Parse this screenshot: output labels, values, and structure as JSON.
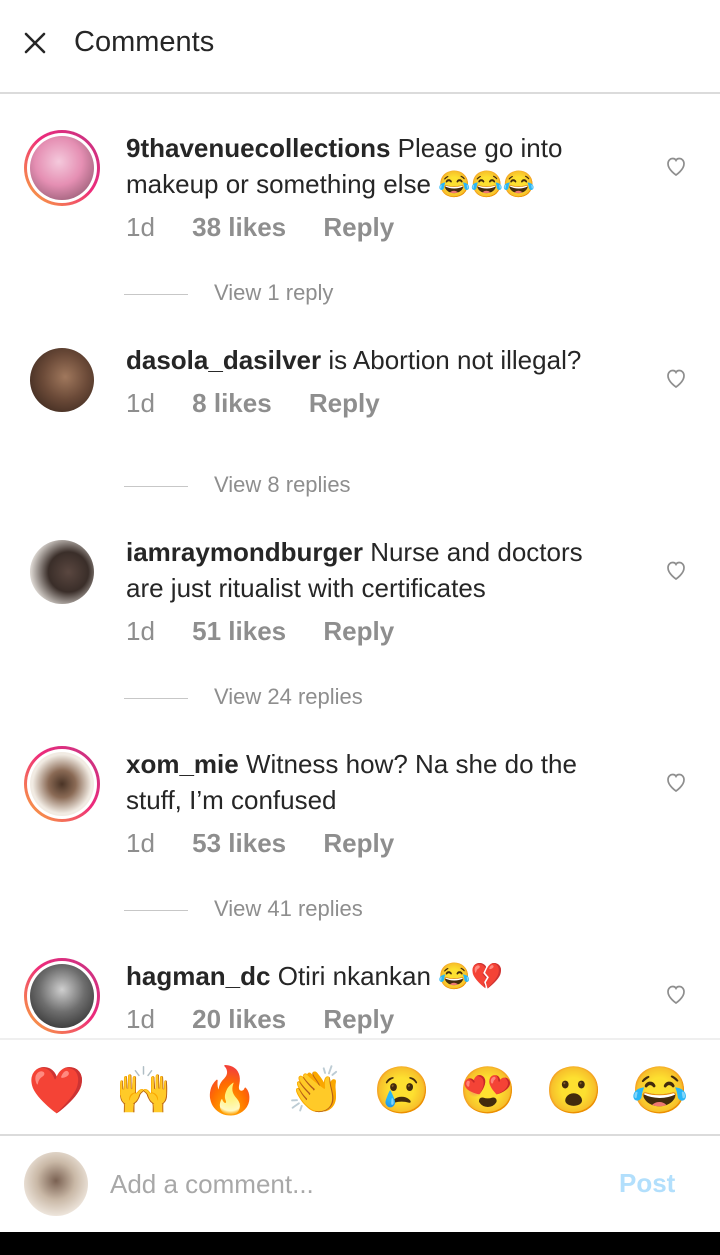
{
  "header": {
    "title": "Comments",
    "close_icon": "close-icon"
  },
  "comments": [
    {
      "username": "9thavenuecollections",
      "text": "Please go into makeup or something else 😂😂😂",
      "time": "1d",
      "likes": "38 likes",
      "reply": "Reply",
      "avatar_colors": [
        "#e9a6c4",
        "#7a4a5e"
      ],
      "story_ring": true,
      "view_replies": "View 1 reply"
    },
    {
      "username": "dasola_dasilver",
      "text": "is Abortion not illegal?",
      "time": "1d",
      "likes": "8 likes",
      "reply": "Reply",
      "avatar_colors": [
        "#6b4a38",
        "#2c1d16"
      ],
      "story_ring": false,
      "view_replies": "View 8 replies"
    },
    {
      "username": "iamraymondburger",
      "text": "Nurse and doctors are just ritualist with certificates",
      "time": "1d",
      "likes": "51 likes",
      "reply": "Reply",
      "avatar_colors": [
        "#d9d4cf",
        "#3a2e29"
      ],
      "story_ring": false,
      "view_replies": "View 24 replies"
    },
    {
      "username": "xom_mie",
      "text": "Witness how? Na she do the stuff, I’m confused",
      "time": "1d",
      "likes": "53 likes",
      "reply": "Reply",
      "avatar_colors": [
        "#f1ebe3",
        "#4a3426"
      ],
      "story_ring": true,
      "view_replies": "View 41 replies"
    },
    {
      "username": "hagman_dc",
      "text": "Otiri nkankan 😂💔",
      "time": "1d",
      "likes": "20 likes",
      "reply": "Reply",
      "avatar_colors": [
        "#cfcfcf",
        "#1f1f1f"
      ],
      "story_ring": true
    }
  ],
  "reactions": [
    "❤️",
    "🙌",
    "🔥",
    "👏",
    "😢",
    "😍",
    "😮",
    "😂"
  ],
  "composer": {
    "placeholder": "Add a comment...",
    "post_label": "Post"
  },
  "colors": {
    "username": "#262626",
    "muted": "#8e8e8e",
    "post_disabled": "#b2dffc"
  }
}
